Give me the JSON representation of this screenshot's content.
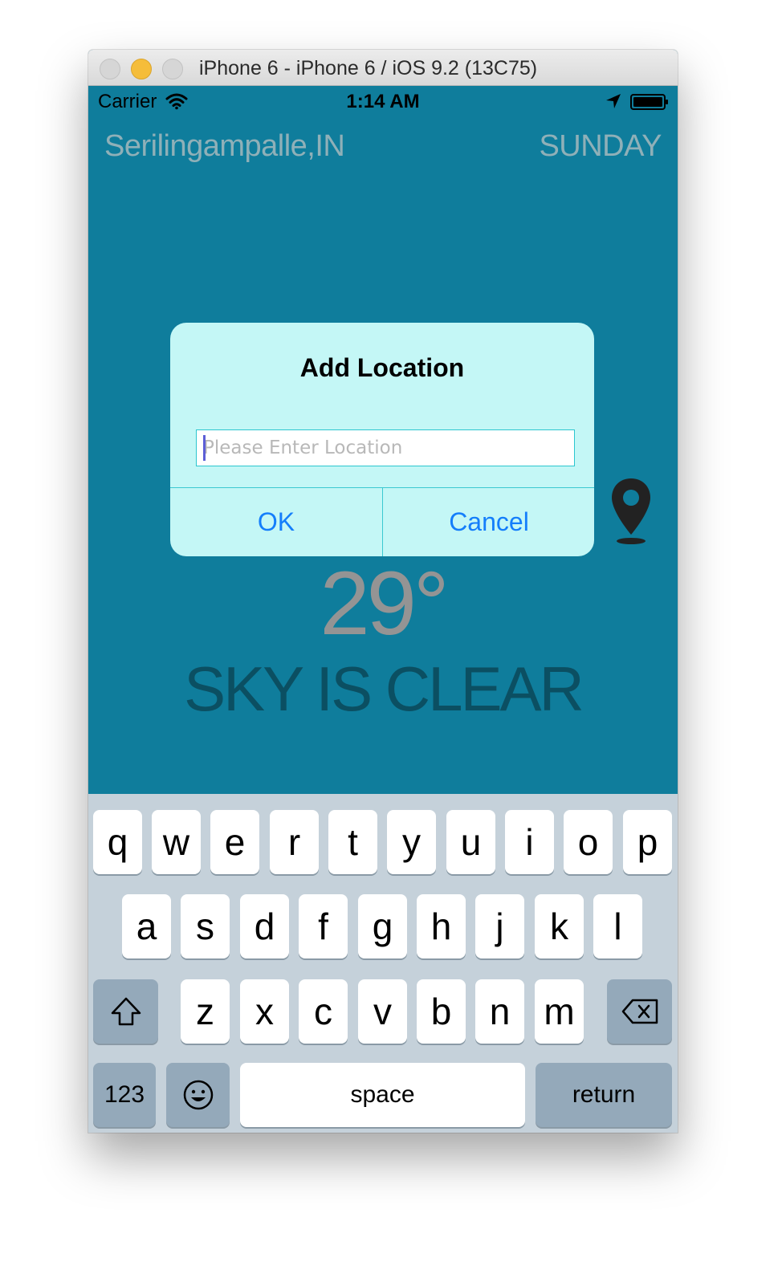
{
  "window": {
    "title": "iPhone 6 - iPhone 6 / iOS 9.2 (13C75)"
  },
  "statusbar": {
    "carrier": "Carrier",
    "time": "1:14 AM"
  },
  "weather": {
    "city": "Serilingampalle,IN",
    "day": "SUNDAY",
    "temperature": "29°",
    "condition": "SKY IS CLEAR"
  },
  "alert": {
    "title": "Add Location",
    "input_placeholder": "Please Enter Location",
    "input_value": "",
    "ok_label": "OK",
    "cancel_label": "Cancel"
  },
  "keyboard": {
    "row1": [
      "q",
      "w",
      "e",
      "r",
      "t",
      "y",
      "u",
      "i",
      "o",
      "p"
    ],
    "row2": [
      "a",
      "s",
      "d",
      "f",
      "g",
      "h",
      "j",
      "k",
      "l"
    ],
    "row3": [
      "z",
      "x",
      "c",
      "v",
      "b",
      "n",
      "m"
    ],
    "numbers_label": "123",
    "space_label": "space",
    "return_label": "return"
  },
  "colors": {
    "app_background": "#0f7d9c",
    "alert_background": "#c4f7f6",
    "button_text": "#147efb",
    "keyboard_background": "#c5d1da"
  },
  "icons": [
    "wifi-icon",
    "location-arrow-icon",
    "battery-icon",
    "map-pin-icon",
    "shift-icon",
    "backspace-icon",
    "emoji-icon"
  ]
}
